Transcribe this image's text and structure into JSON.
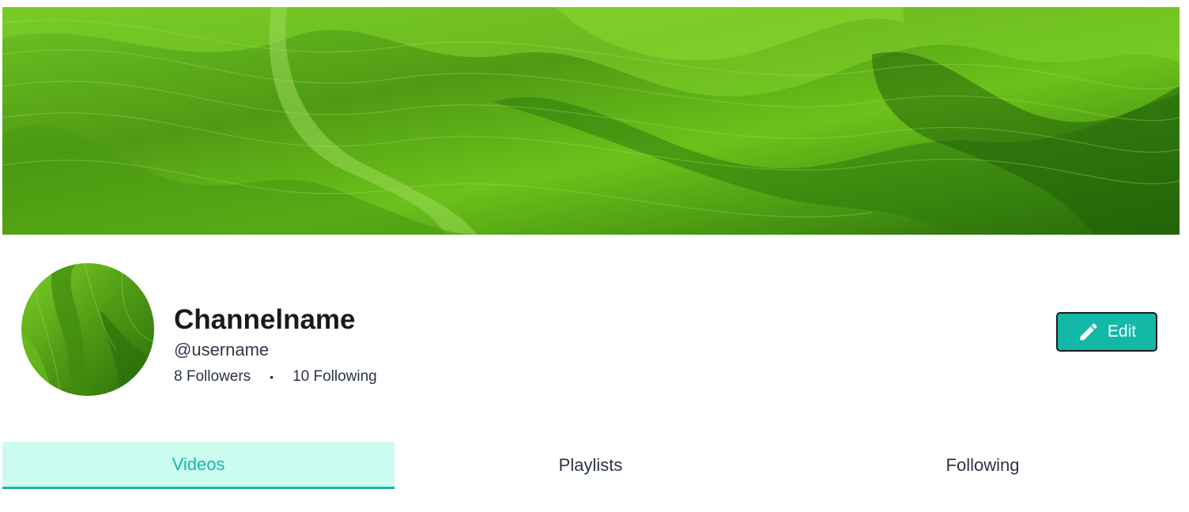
{
  "banner": {
    "icon": "green-abstract-banner-image"
  },
  "profile": {
    "avatar_icon": "green-abstract-avatar-image",
    "channel_name": "Channelname",
    "username": "@username",
    "followers": "8 Followers",
    "separator": "•",
    "following": "10 Following"
  },
  "edit_button": {
    "label": "Edit",
    "icon": "pencil-icon"
  },
  "tabs": [
    {
      "label": "Videos",
      "active": true
    },
    {
      "label": "Playlists",
      "active": false
    },
    {
      "label": "Following",
      "active": false
    }
  ],
  "colors": {
    "accent": "#14b8a6",
    "active_tab_bg": "#ccfbef",
    "banner_green": "#5aa812"
  }
}
